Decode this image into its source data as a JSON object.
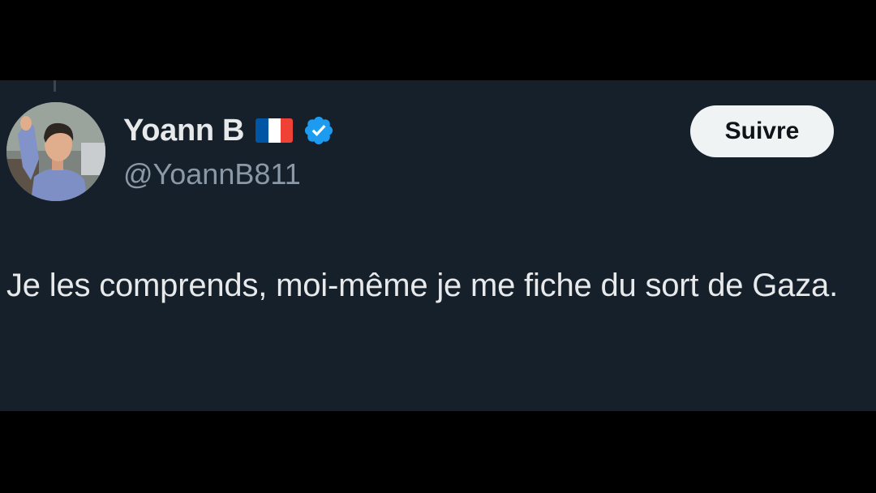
{
  "colors": {
    "page_background": "#000000",
    "card_background": "#15202b",
    "name_text": "#e7e9ea",
    "handle_text": "#8b98a5",
    "verified_badge": "#1d9bf0",
    "follow_button_bg": "#eff3f4",
    "follow_button_text": "#0f1419",
    "flag_colors": [
      "#0055a4",
      "#ffffff",
      "#ef4135"
    ]
  },
  "author": {
    "display_name": "Yoann B",
    "flag_icon": "france-flag-icon",
    "verified_icon": "verified-badge-icon",
    "handle": "@YoannB811",
    "avatar_icon": "profile-avatar"
  },
  "actions": {
    "follow_label": "Suivre"
  },
  "tweet": {
    "text": "Je les comprends, moi-même je me fiche du sort de Gaza."
  }
}
